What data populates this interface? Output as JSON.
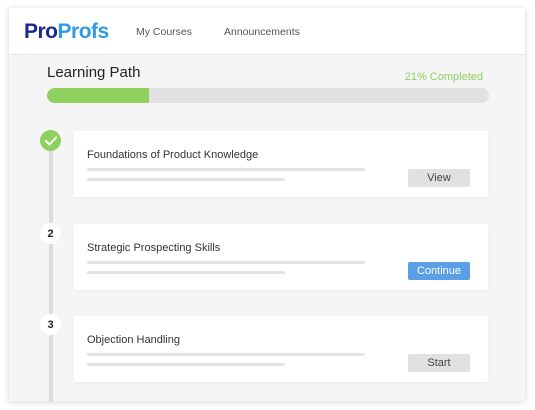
{
  "header": {
    "logo_part1": "Pro",
    "logo_part2": "Profs",
    "nav": [
      "My Courses",
      "Announcements"
    ]
  },
  "learning_path": {
    "title": "Learning Path",
    "progress_label": "21% Completed",
    "progress_fraction": 0.23
  },
  "steps": [
    {
      "marker": "✓",
      "status": "completed",
      "title": "Foundations of Product Knowledge",
      "action": "View"
    },
    {
      "marker": "2",
      "status": "current",
      "title": "Strategic Prospecting Skills",
      "action": "Continue"
    },
    {
      "marker": "3",
      "status": "not-started",
      "title": "Objection Handling",
      "action": "Start"
    }
  ],
  "colors": {
    "accent_green": "#8fd15f",
    "accent_blue": "#5a9fe6",
    "logo_navy": "#1a2a8a",
    "logo_blue": "#2d9be6"
  }
}
